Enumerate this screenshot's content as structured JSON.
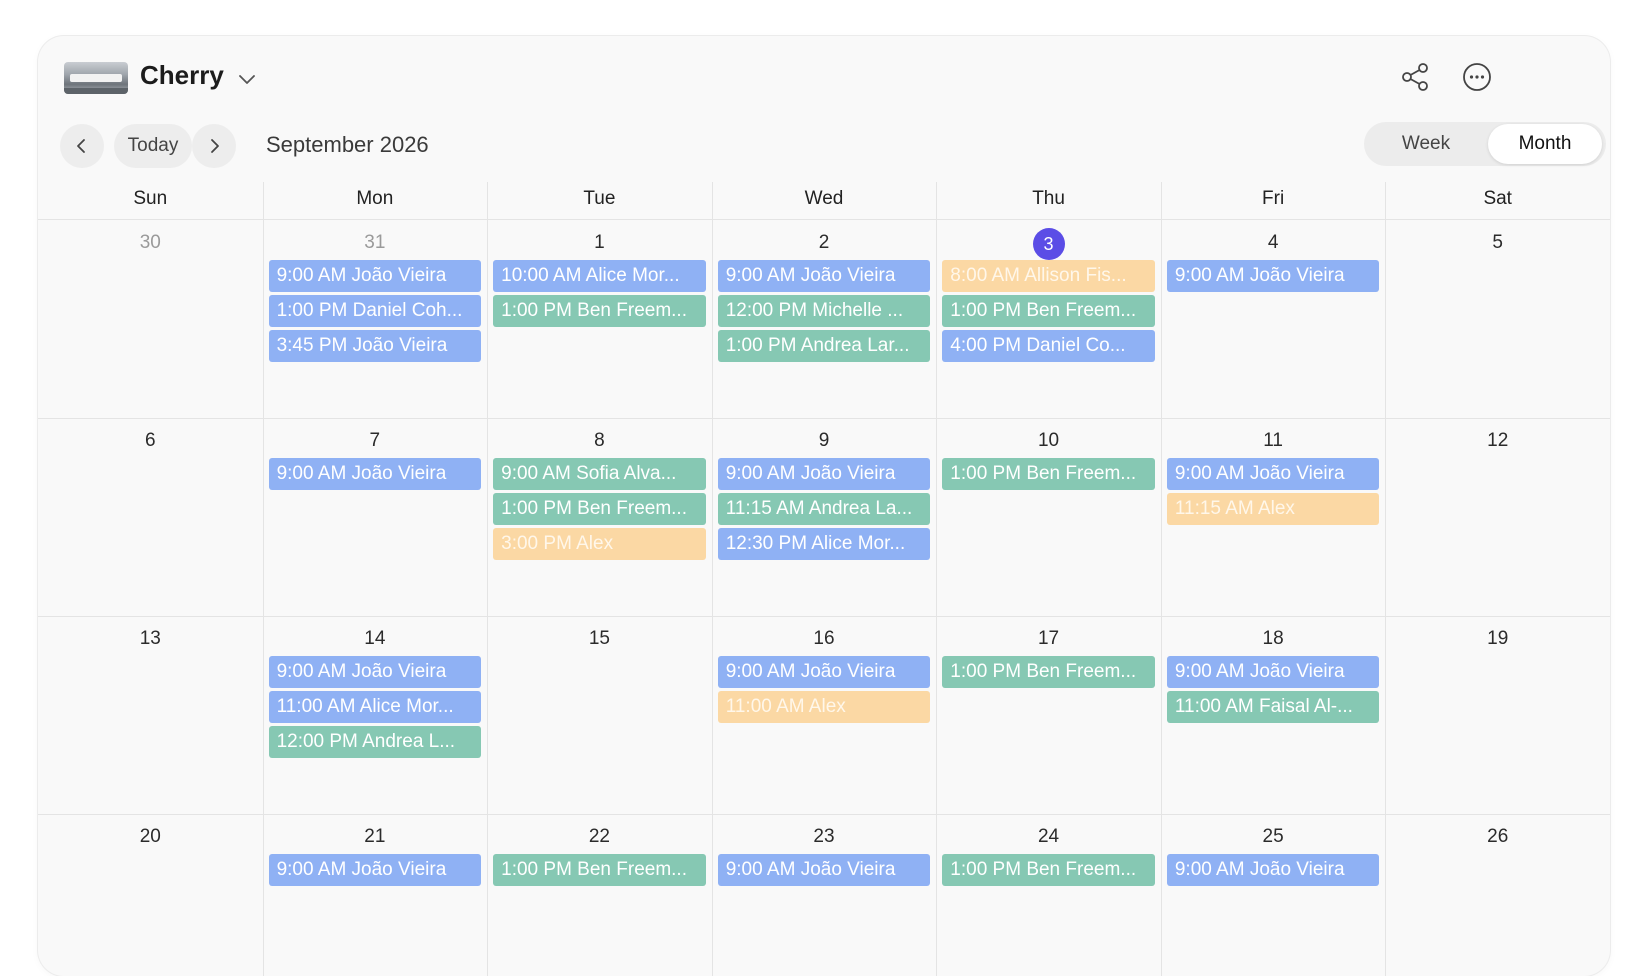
{
  "header": {
    "calendar_name": "Cherry",
    "icons": [
      "calendar-thumbnail",
      "chevron-down-icon",
      "share-icon",
      "more-icon"
    ]
  },
  "toolbar": {
    "today_label": "Today",
    "month_title": "September 2026",
    "view_week": "Week",
    "view_month": "Month",
    "selected_view": "Month"
  },
  "weekdays": [
    "Sun",
    "Mon",
    "Tue",
    "Wed",
    "Thu",
    "Fri",
    "Sat"
  ],
  "colors": {
    "blue": "#8fb1f4",
    "green": "#86c8b3",
    "yellow": "#fbd8a4",
    "today": "#5b4de6"
  },
  "weeks": [
    [
      {
        "day": "30",
        "muted": true,
        "events": []
      },
      {
        "day": "31",
        "muted": true,
        "events": [
          {
            "text": "9:00 AM João Vieira",
            "color": "blue"
          },
          {
            "text": "1:00 PM Daniel Coh...",
            "color": "blue"
          },
          {
            "text": "3:45 PM João Vieira",
            "color": "blue"
          }
        ]
      },
      {
        "day": "1",
        "events": [
          {
            "text": "10:00 AM Alice Mor...",
            "color": "blue"
          },
          {
            "text": "1:00 PM Ben Freem...",
            "color": "green"
          }
        ]
      },
      {
        "day": "2",
        "events": [
          {
            "text": "9:00 AM João Vieira",
            "color": "blue"
          },
          {
            "text": "12:00 PM Michelle ...",
            "color": "green"
          },
          {
            "text": "1:00 PM Andrea Lar...",
            "color": "green"
          }
        ]
      },
      {
        "day": "3",
        "today": true,
        "events": [
          {
            "text": "8:00 AM Allison Fis...",
            "color": "yellow"
          },
          {
            "text": "1:00 PM Ben Freem...",
            "color": "green"
          },
          {
            "text": "4:00 PM Daniel Co...",
            "color": "blue"
          }
        ]
      },
      {
        "day": "4",
        "events": [
          {
            "text": "9:00 AM João Vieira",
            "color": "blue"
          }
        ]
      },
      {
        "day": "5",
        "events": []
      }
    ],
    [
      {
        "day": "6",
        "events": []
      },
      {
        "day": "7",
        "events": [
          {
            "text": "9:00 AM João Vieira",
            "color": "blue"
          }
        ]
      },
      {
        "day": "8",
        "events": [
          {
            "text": "9:00 AM Sofia Alva...",
            "color": "green"
          },
          {
            "text": "1:00 PM Ben Freem...",
            "color": "green"
          },
          {
            "text": "3:00 PM Alex",
            "color": "yellow"
          }
        ]
      },
      {
        "day": "9",
        "events": [
          {
            "text": "9:00 AM João Vieira",
            "color": "blue"
          },
          {
            "text": "11:15 AM Andrea La...",
            "color": "green"
          },
          {
            "text": "12:30 PM Alice Mor...",
            "color": "blue"
          }
        ]
      },
      {
        "day": "10",
        "events": [
          {
            "text": "1:00 PM Ben Freem...",
            "color": "green"
          }
        ]
      },
      {
        "day": "11",
        "events": [
          {
            "text": "9:00 AM João Vieira",
            "color": "blue"
          },
          {
            "text": "11:15 AM Alex",
            "color": "yellow"
          }
        ]
      },
      {
        "day": "12",
        "events": []
      }
    ],
    [
      {
        "day": "13",
        "events": []
      },
      {
        "day": "14",
        "events": [
          {
            "text": "9:00 AM João Vieira",
            "color": "blue"
          },
          {
            "text": "11:00 AM Alice Mor...",
            "color": "blue"
          },
          {
            "text": "12:00 PM Andrea L...",
            "color": "green"
          }
        ]
      },
      {
        "day": "15",
        "events": []
      },
      {
        "day": "16",
        "events": [
          {
            "text": "9:00 AM João Vieira",
            "color": "blue"
          },
          {
            "text": "11:00 AM Alex",
            "color": "yellow"
          }
        ]
      },
      {
        "day": "17",
        "events": [
          {
            "text": "1:00 PM Ben Freem...",
            "color": "green"
          }
        ]
      },
      {
        "day": "18",
        "events": [
          {
            "text": "9:00 AM João Vieira",
            "color": "blue"
          },
          {
            "text": "11:00 AM Faisal Al-...",
            "color": "green"
          }
        ]
      },
      {
        "day": "19",
        "events": []
      }
    ],
    [
      {
        "day": "20",
        "events": []
      },
      {
        "day": "21",
        "events": [
          {
            "text": "9:00 AM João Vieira",
            "color": "blue"
          }
        ]
      },
      {
        "day": "22",
        "events": [
          {
            "text": "1:00 PM Ben Freem...",
            "color": "green"
          }
        ]
      },
      {
        "day": "23",
        "events": [
          {
            "text": "9:00 AM João Vieira",
            "color": "blue"
          }
        ]
      },
      {
        "day": "24",
        "events": [
          {
            "text": "1:00 PM Ben Freem...",
            "color": "green"
          }
        ]
      },
      {
        "day": "25",
        "events": [
          {
            "text": "9:00 AM João Vieira",
            "color": "blue"
          }
        ]
      },
      {
        "day": "26",
        "events": []
      }
    ]
  ]
}
